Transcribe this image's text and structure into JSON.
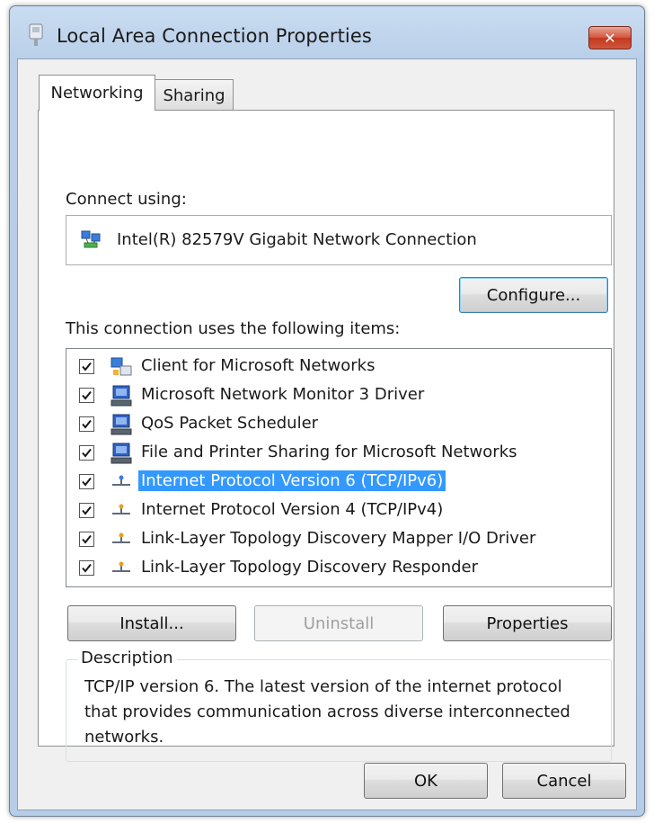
{
  "window": {
    "title": "Local Area Connection Properties",
    "close_glyph": "✕"
  },
  "tabs": [
    {
      "label": "Networking",
      "active": true
    },
    {
      "label": "Sharing",
      "active": false
    }
  ],
  "connect_using": {
    "label": "Connect using:",
    "device": "Intel(R) 82579V Gigabit Network Connection",
    "configure_label": "Configure..."
  },
  "items_section": {
    "label": "This connection uses the following items:",
    "items": [
      {
        "label": "Client for Microsoft Networks",
        "checked": true,
        "icon": "network-client-icon",
        "selected": false
      },
      {
        "label": "Microsoft Network Monitor 3 Driver",
        "checked": true,
        "icon": "network-service-icon",
        "selected": false
      },
      {
        "label": "QoS Packet Scheduler",
        "checked": true,
        "icon": "network-service-icon",
        "selected": false
      },
      {
        "label": "File and Printer Sharing for Microsoft Networks",
        "checked": true,
        "icon": "network-service-icon",
        "selected": false
      },
      {
        "label": "Internet Protocol Version 6 (TCP/IPv6)",
        "checked": true,
        "icon": "protocol-icon",
        "selected": true
      },
      {
        "label": "Internet Protocol Version 4 (TCP/IPv4)",
        "checked": true,
        "icon": "protocol-icon",
        "selected": false
      },
      {
        "label": "Link-Layer Topology Discovery Mapper I/O Driver",
        "checked": true,
        "icon": "protocol-icon",
        "selected": false
      },
      {
        "label": "Link-Layer Topology Discovery Responder",
        "checked": true,
        "icon": "protocol-icon",
        "selected": false
      }
    ]
  },
  "item_buttons": {
    "install": "Install...",
    "uninstall": "Uninstall",
    "properties": "Properties"
  },
  "description": {
    "legend": "Description",
    "text": "TCP/IP version 6. The latest version of the internet protocol that provides communication across diverse interconnected networks."
  },
  "footer": {
    "ok": "OK",
    "cancel": "Cancel"
  },
  "colors": {
    "selection": "#3399ff",
    "title_bar": "#c9dcf1",
    "close_button": "#c2381f"
  }
}
